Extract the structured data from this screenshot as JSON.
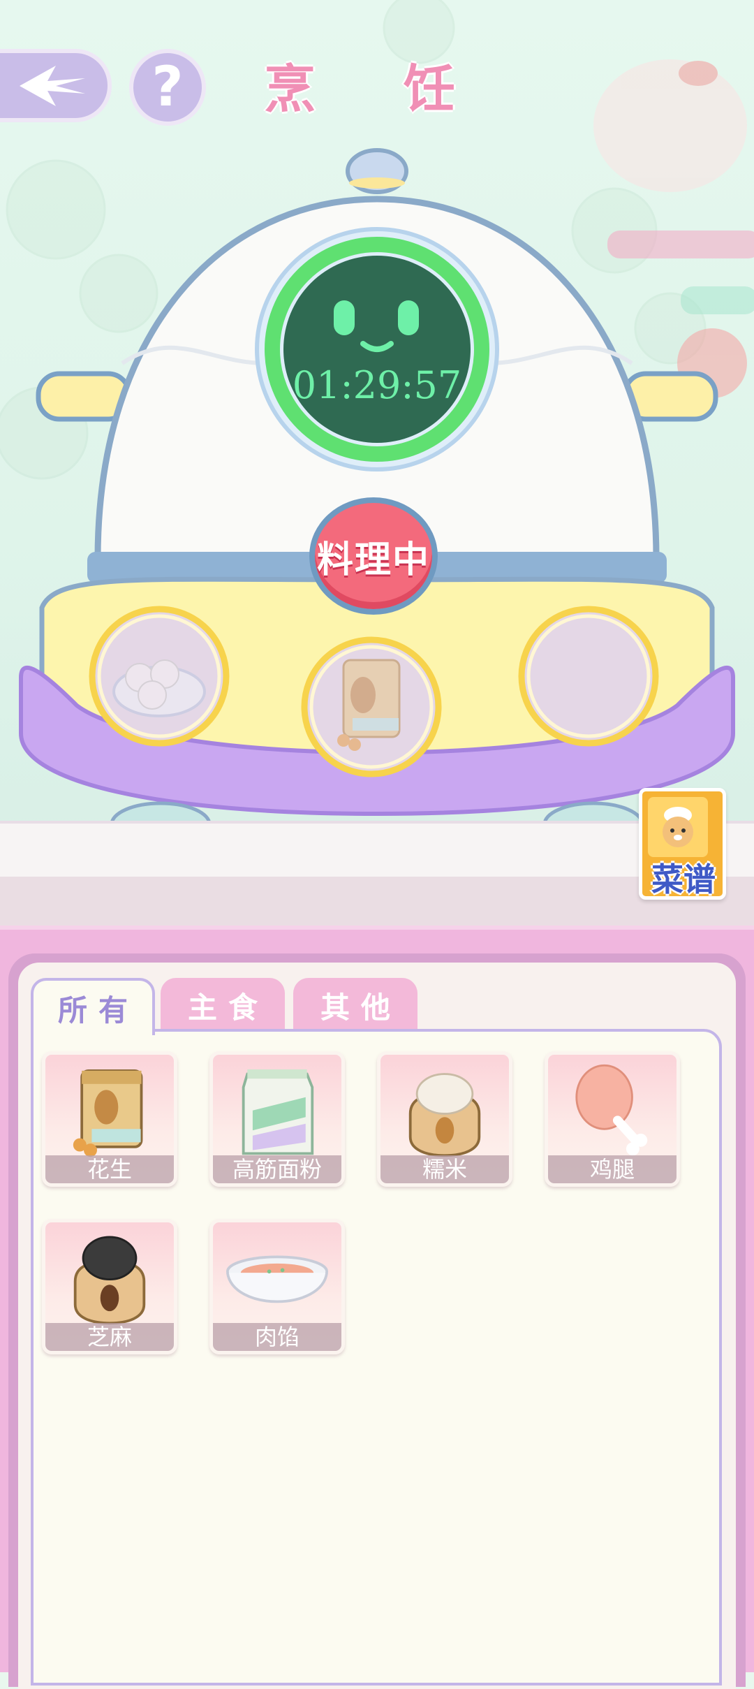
{
  "screen": {
    "title": "烹 饪",
    "back_icon": "back-arrow-icon",
    "help_label": "?"
  },
  "cooker": {
    "timer": "01:29:57",
    "status_label": "料理中",
    "slots": [
      {
        "ingredient": "bowl-of-dough-balls"
      },
      {
        "ingredient": "peanut-bag"
      },
      {
        "ingredient": "empty"
      }
    ]
  },
  "recipe_book": {
    "label": "菜谱"
  },
  "inventory": {
    "tabs": [
      {
        "label": "所有",
        "active": true
      },
      {
        "label": "主食",
        "active": false
      },
      {
        "label": "其他",
        "active": false
      }
    ],
    "items": [
      {
        "name": "花生",
        "icon": "peanut-bag-icon"
      },
      {
        "name": "高筋面粉",
        "icon": "flour-bag-icon"
      },
      {
        "name": "糯米",
        "icon": "rice-sack-icon"
      },
      {
        "name": "鸡腿",
        "icon": "chicken-leg-icon"
      },
      {
        "name": "芝麻",
        "icon": "sesame-sack-icon"
      },
      {
        "name": "肉馅",
        "icon": "meat-filling-bowl-icon"
      }
    ]
  },
  "colors": {
    "accent_pink": "#f08fb5",
    "status_red": "#f36a7c",
    "timer_green": "#6ef0a8",
    "tab_purple": "#9b8ad6"
  }
}
